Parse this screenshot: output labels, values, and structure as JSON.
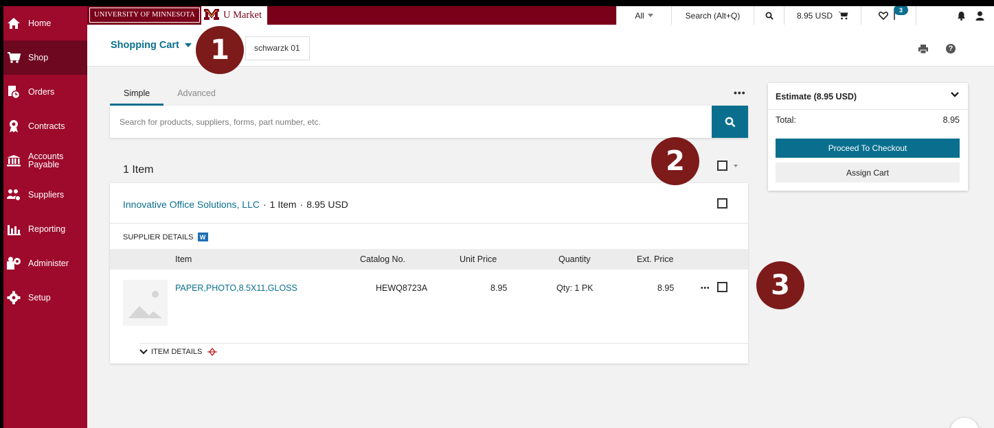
{
  "sidebar": {
    "items": [
      {
        "label": "Home",
        "icon": "home-icon"
      },
      {
        "label": "Shop",
        "icon": "cart-icon",
        "active": true
      },
      {
        "label": "Orders",
        "icon": "orders-icon"
      },
      {
        "label": "Contracts",
        "icon": "contracts-icon"
      },
      {
        "label": "Accounts Payable",
        "icon": "bank-icon"
      },
      {
        "label": "Suppliers",
        "icon": "suppliers-icon"
      },
      {
        "label": "Reporting",
        "icon": "chart-icon"
      },
      {
        "label": "Administer",
        "icon": "administer-icon"
      },
      {
        "label": "Setup",
        "icon": "gear-icon"
      }
    ]
  },
  "topbar": {
    "university": "University of Minnesota",
    "brand": "U Market",
    "search_scope": "All",
    "search_placeholder": "Search (Alt+Q)",
    "cart_total": "8.95 USD",
    "notification_count": "3"
  },
  "header": {
    "title": "Shopping Cart",
    "cart_name": "schwarzk 01"
  },
  "callouts": [
    "1",
    "2",
    "3"
  ],
  "tabs": [
    {
      "label": "Simple",
      "active": true
    },
    {
      "label": "Advanced",
      "active": false
    }
  ],
  "search": {
    "placeholder": "Search for products, suppliers, forms, part number, etc."
  },
  "cart": {
    "item_count": "1 Item",
    "supplier": {
      "name": "Innovative Office Solutions, LLC",
      "items": "1 Item",
      "total": "8.95 USD",
      "details_label": "SUPPLIER DETAILS",
      "badge": "W"
    },
    "columns": [
      "Item",
      "Catalog No.",
      "Unit Price",
      "Quantity",
      "Ext. Price"
    ],
    "line": {
      "item": "PAPER,PHOTO,8.5X11,GLOSS",
      "catalog": "HEWQ8723A",
      "unit_price": "8.95",
      "quantity": "Qty: 1 PK",
      "ext_price": "8.95"
    },
    "item_details_label": "ITEM DETAILS"
  },
  "estimate": {
    "title": "Estimate (8.95 USD)",
    "total_label": "Total:",
    "total_value": "8.95",
    "checkout_label": "Proceed To Checkout",
    "assign_label": "Assign Cart"
  },
  "colors": {
    "maroon": "#9d0a2c",
    "maroon_dark": "#7a0019",
    "teal": "#0a6f8f",
    "callout": "#7d1a1a"
  }
}
